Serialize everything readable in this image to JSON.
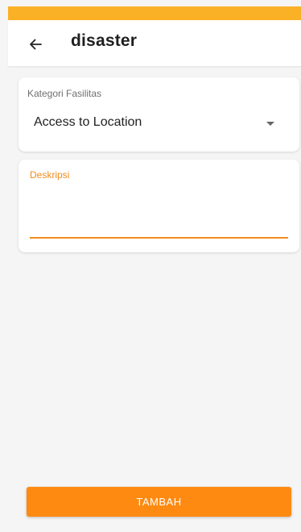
{
  "colors": {
    "status_bar": "#fbb126",
    "accent": "#f28c1c",
    "button": "#ff8a12",
    "button_text": "#ffffff",
    "background": "#f5f5f5",
    "card": "#ffffff"
  },
  "app_bar": {
    "back_icon": "arrow-left-icon",
    "title": "disaster"
  },
  "form": {
    "category": {
      "label": "Kategori Fasilitas",
      "selected_value": "Access to Location",
      "icon": "dropdown-caret-icon"
    },
    "description": {
      "label": "Deskripsi",
      "value": ""
    }
  },
  "actions": {
    "submit_label": "TAMBAH"
  }
}
